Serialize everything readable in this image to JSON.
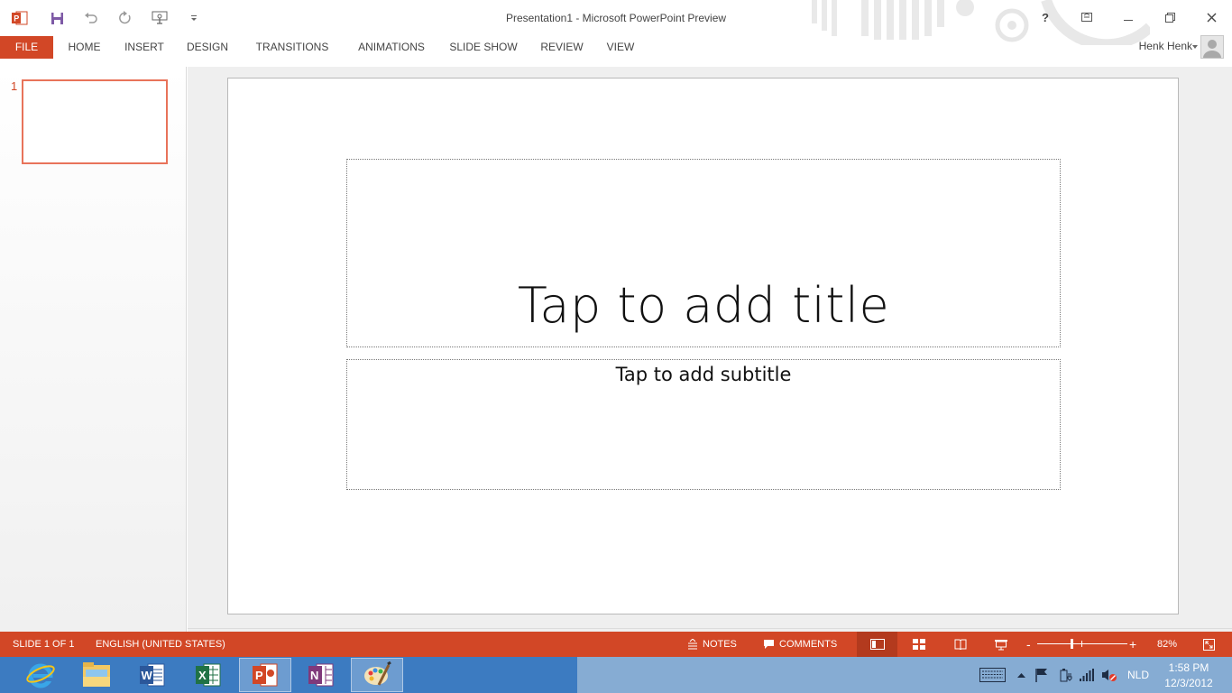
{
  "window": {
    "title": "Presentation1 - Microsoft PowerPoint Preview",
    "help": "?"
  },
  "qat": {
    "icons": [
      "powerpoint-logo-icon",
      "save-icon",
      "undo-icon",
      "redo-icon",
      "touch-mode-icon",
      "customize-qat-icon"
    ]
  },
  "ribbon": {
    "tabs": [
      "FILE",
      "HOME",
      "INSERT",
      "DESIGN",
      "TRANSITIONS",
      "ANIMATIONS",
      "SLIDE SHOW",
      "REVIEW",
      "VIEW"
    ]
  },
  "user": {
    "name": "Henk Henk"
  },
  "thumbnails": [
    {
      "number": "1"
    }
  ],
  "slide": {
    "title_placeholder": "Tap to add title",
    "subtitle_placeholder": "Tap to add subtitle"
  },
  "status": {
    "slide_info": "SLIDE 1 OF 1",
    "language": "ENGLISH (UNITED STATES)",
    "notes": "NOTES",
    "comments": "COMMENTS",
    "zoom": "82%",
    "zoom_minus": "-",
    "zoom_plus": "+",
    "views": [
      "normal-view-icon",
      "slide-sorter-icon",
      "reading-view-icon",
      "slide-show-icon"
    ],
    "active_view": "normal-view-icon"
  },
  "taskbar": {
    "apps": [
      "internet-explorer-icon",
      "file-explorer-icon",
      "word-icon",
      "excel-icon",
      "powerpoint-icon",
      "onenote-icon",
      "paint-icon"
    ],
    "active_app": "powerpoint-icon",
    "language": "NLD",
    "time": "1:58 PM",
    "date": "12/3/2012"
  },
  "colors": {
    "accent": "#D24726",
    "accent_dark": "#B33A1E",
    "taskbar": "#3c7bc1"
  }
}
